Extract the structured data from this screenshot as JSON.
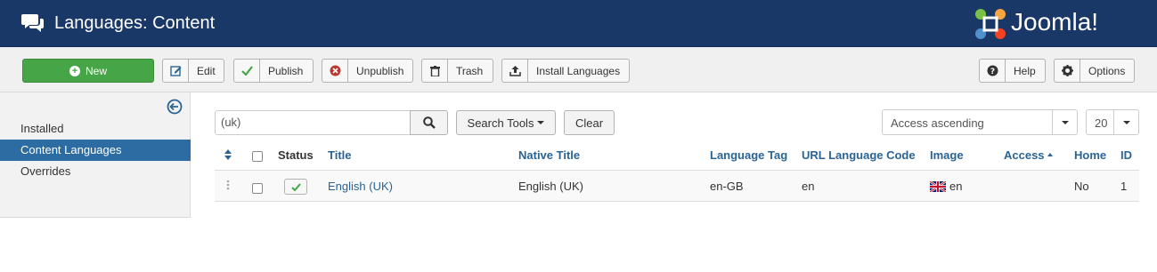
{
  "header": {
    "title": "Languages: Content",
    "logo_text": "Joomla!"
  },
  "toolbar": {
    "new_label": "New",
    "edit_label": "Edit",
    "publish_label": "Publish",
    "unpublish_label": "Unpublish",
    "trash_label": "Trash",
    "install_label": "Install Languages",
    "help_label": "Help",
    "options_label": "Options"
  },
  "sidebar": {
    "items": [
      {
        "label": "Installed",
        "active": false
      },
      {
        "label": "Content Languages",
        "active": true
      },
      {
        "label": "Overrides",
        "active": false
      }
    ]
  },
  "filters": {
    "search_value": "(uk)",
    "search_tools_label": "Search Tools",
    "clear_label": "Clear",
    "ordering_value": "Access ascending",
    "limit_value": "20"
  },
  "table": {
    "headers": {
      "status": "Status",
      "title": "Title",
      "native_title": "Native Title",
      "language_tag": "Language Tag",
      "url_code": "URL Language Code",
      "image": "Image",
      "access": "Access",
      "home": "Home",
      "id": "ID"
    },
    "rows": [
      {
        "title": "English (UK)",
        "native_title": "English (UK)",
        "language_tag": "en-GB",
        "url_code": "en",
        "image_label": "en",
        "access": "",
        "home": "No",
        "id": "1",
        "published": true
      }
    ]
  },
  "colors": {
    "header_bg": "#1a3867",
    "new_button": "#46a546",
    "link": "#2a6496",
    "sidebar_active": "#2d6ca2"
  }
}
